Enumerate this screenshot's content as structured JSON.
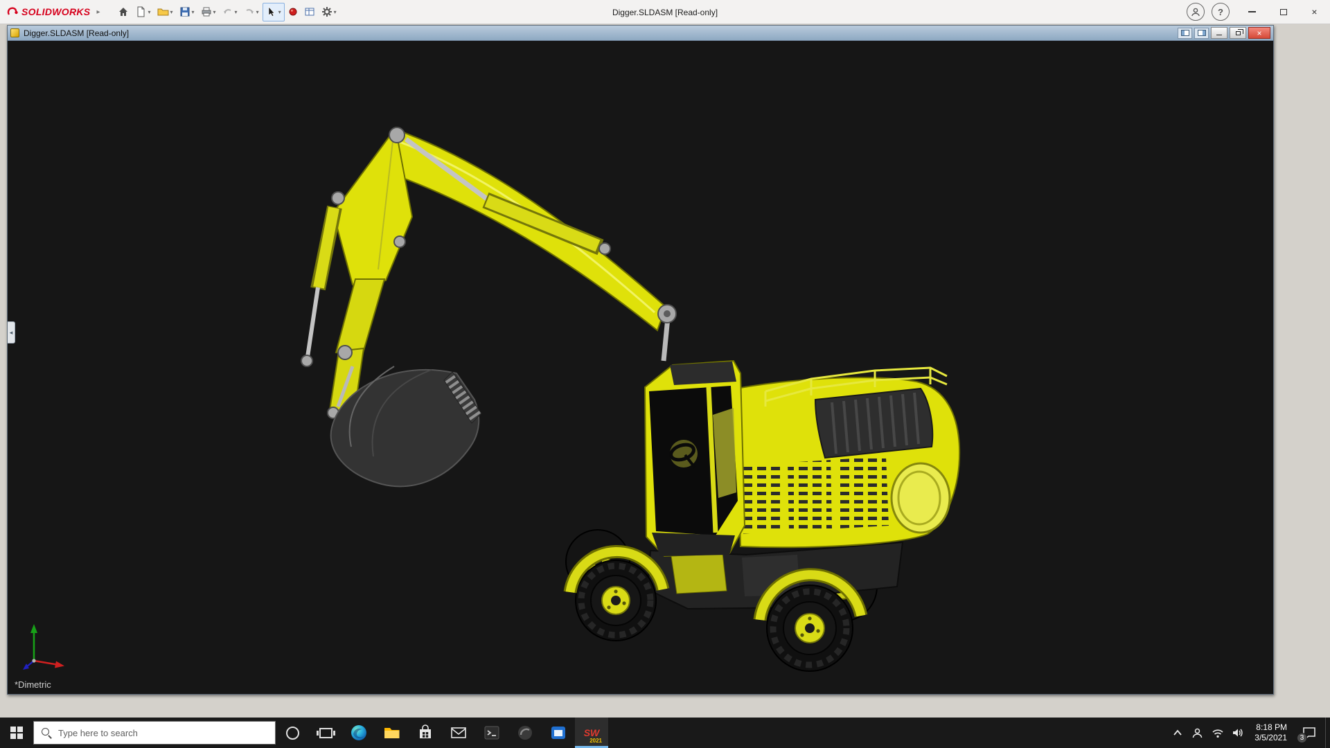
{
  "app": {
    "brand": "SOLIDWORKS",
    "title": "Digger.SLDASM [Read-only]",
    "toolbar_icon_names": [
      "home-icon",
      "new-document-icon",
      "open-icon",
      "save-icon",
      "print-icon",
      "undo-icon",
      "redo-icon",
      "select-arrow-icon",
      "appearance-bead-icon",
      "document-properties-icon",
      "options-gear-icon"
    ],
    "window_control_names": [
      "user-account-icon",
      "help-icon",
      "minimize-icon",
      "maximize-icon",
      "close-icon"
    ]
  },
  "document_window": {
    "title": "Digger.SLDASM [Read-only]",
    "control_names": [
      "pane-toggle-left-icon",
      "pane-toggle-right-icon",
      "minimize-icon",
      "restore-icon",
      "close-icon"
    ]
  },
  "viewport": {
    "orientation_label": "*Dimetric",
    "model_description": "Yellow wheeled excavator 3D assembly on dark background",
    "background_color": "#161616",
    "model_color": "#dfe10a",
    "triad_axis_colors": {
      "x": "#d02020",
      "y": "#18a018",
      "z": "#2020c0"
    }
  },
  "taskbar": {
    "search_placeholder": "Type here to search",
    "pinned_icon_names": [
      "start-icon",
      "cortana-icon",
      "task-view-icon",
      "edge-icon",
      "file-explorer-icon",
      "store-icon",
      "mail-icon",
      "console-icon",
      "dark-app-icon",
      "media-app-icon",
      "solidworks-icon"
    ],
    "solidworks_badge": {
      "label": "SW",
      "year": "2021"
    },
    "tray_icon_names": [
      "hidden-icons-chevron",
      "contacts-icon",
      "network-icon",
      "volume-icon",
      "action-center-icon"
    ],
    "clock": {
      "time": "8:18 PM",
      "date": "3/5/2021"
    },
    "action_center_badge": "3"
  },
  "colors": {
    "accent_yellow": "#dfe10a",
    "taskbar_bg": "#191919",
    "child_titlebar": "#90abc4",
    "close_red": "#d64a38",
    "brand_red": "#d6001c"
  }
}
